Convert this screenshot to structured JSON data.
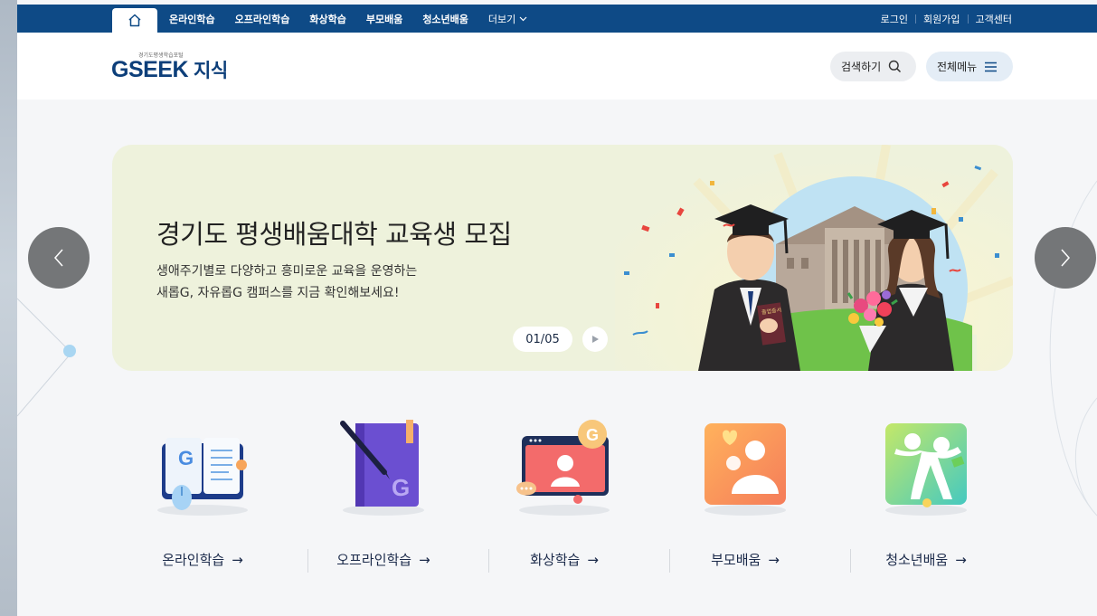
{
  "topnav": {
    "home_label": "",
    "items": [
      "온라인학습",
      "오프라인학습",
      "화상학습",
      "부모배움",
      "청소년배움"
    ],
    "more_label": "더보기",
    "util": [
      "로그인",
      "회원가입",
      "고객센터"
    ]
  },
  "header": {
    "logo_tagline": "경기도평생학습포털",
    "logo_text": "GSEEK",
    "logo_korean": "지식",
    "search_label": "검색하기",
    "menu_label": "전체메뉴"
  },
  "banner": {
    "title": "경기도 평생배움대학 교육생 모집",
    "desc_line1": "생애주기별로 다양하고 흥미로운 교육을 운영하는",
    "desc_line2": "새롭G, 자유롭G 캠퍼스를 지금 확인해보세요!",
    "counter": "01/05",
    "book_text": "졸업증서"
  },
  "quick": [
    {
      "label": "온라인학습",
      "arrow": "→"
    },
    {
      "label": "오프라인학습",
      "arrow": "→"
    },
    {
      "label": "화상학습",
      "arrow": "→"
    },
    {
      "label": "부모배움",
      "arrow": "→"
    },
    {
      "label": "청소년배움",
      "arrow": "→"
    }
  ],
  "colors": {
    "nav_bg": "#0e4a86",
    "banner_bg": "#eef2dc",
    "text_dark": "#1b2a4a"
  }
}
